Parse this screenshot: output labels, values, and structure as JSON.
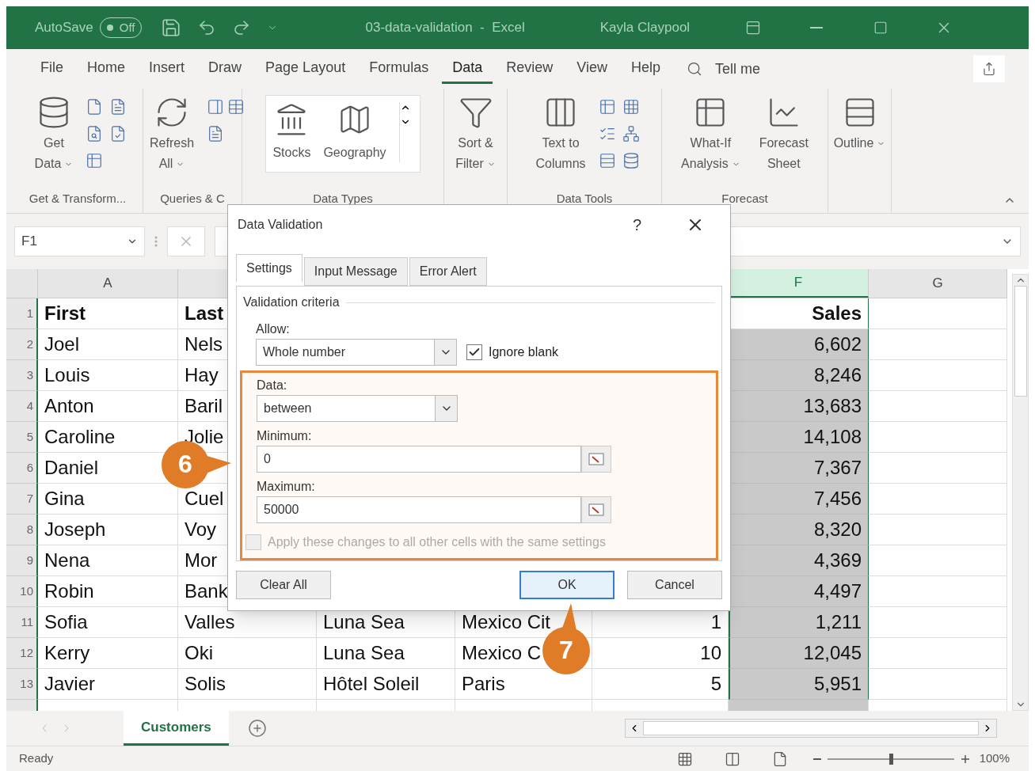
{
  "title_bar": {
    "autosave": {
      "label": "AutoSave",
      "state": "Off",
      "on": false
    },
    "title": "03-data-validation  -  Excel",
    "user": "Kayla Claypool"
  },
  "ribbon_tabs": [
    {
      "label": "File",
      "selected": false
    },
    {
      "label": "Home",
      "selected": false
    },
    {
      "label": "Insert",
      "selected": false
    },
    {
      "label": "Draw",
      "selected": false
    },
    {
      "label": "Page Layout",
      "selected": false
    },
    {
      "label": "Formulas",
      "selected": false
    },
    {
      "label": "Data",
      "selected": true
    },
    {
      "label": "Review",
      "selected": false
    },
    {
      "label": "View",
      "selected": false
    },
    {
      "label": "Help",
      "selected": false
    }
  ],
  "tell_me": "Tell me",
  "ribbon": {
    "groups": [
      {
        "kind": "buttons",
        "label": "Get & Transform...",
        "buttons": [
          {
            "lines": [
              "Get",
              "Data"
            ],
            "dropdown": true
          }
        ]
      },
      {
        "kind": "buttons",
        "label": "Queries & C",
        "buttons": [
          {
            "lines": [
              "Refresh",
              "All"
            ],
            "dropdown": true
          }
        ]
      },
      {
        "kind": "gallery",
        "label": "Data Types",
        "buttons": [
          {
            "lines": [
              "Stocks"
            ]
          },
          {
            "lines": [
              "Geography"
            ]
          }
        ]
      },
      {
        "kind": "buttons",
        "buttons": [
          {
            "lines": [
              "Sort &",
              "Filter"
            ],
            "dropdown": true
          }
        ]
      },
      {
        "kind": "buttons",
        "label": "Data Tools",
        "buttons": [
          {
            "lines": [
              "Text to",
              "Columns"
            ],
            "dropdown": false
          }
        ]
      },
      {
        "kind": "buttons",
        "label": "Forecast",
        "buttons": [
          {
            "lines": [
              "What-If",
              "Analysis"
            ],
            "dropdown": true
          },
          {
            "lines": [
              "Forecast",
              "Sheet"
            ],
            "dropdown": false
          }
        ]
      },
      {
        "kind": "buttons",
        "buttons": [
          {
            "lines": [
              "Outline"
            ],
            "dropdown": true
          }
        ]
      }
    ]
  },
  "formula_bar": {
    "name_box": "F1"
  },
  "sheet": {
    "columns": [
      {
        "label": "A",
        "selected": false
      },
      {
        "label": "F",
        "selected": true
      },
      {
        "label": "G",
        "selected": false
      }
    ],
    "rows": [
      {
        "number": "1",
        "cells": {
          "A": "First",
          "B": "Last",
          "F": "Sales"
        }
      },
      {
        "number": "2",
        "cells": {
          "A": "Joel",
          "B": "Nels",
          "F": "6,602"
        }
      },
      {
        "number": "3",
        "cells": {
          "A": "Louis",
          "B": "Hay",
          "F": "8,246"
        }
      },
      {
        "number": "4",
        "cells": {
          "A": "Anton",
          "B": "Baril",
          "F": "13,683"
        }
      },
      {
        "number": "5",
        "cells": {
          "A": "Caroline",
          "B": "Jolie",
          "F": "14,108"
        }
      },
      {
        "number": "6",
        "cells": {
          "A": "Daniel",
          "F": "7,367"
        }
      },
      {
        "number": "7",
        "cells": {
          "A": "Gina",
          "B": "Cuel",
          "F": "7,456"
        }
      },
      {
        "number": "8",
        "cells": {
          "A": "Joseph",
          "B": "Voy",
          "F": "8,320"
        }
      },
      {
        "number": "9",
        "cells": {
          "A": "Nena",
          "B": "Mor",
          "F": "4,369"
        }
      },
      {
        "number": "10",
        "cells": {
          "A": "Robin",
          "B": "Bank",
          "F": "4,497"
        }
      },
      {
        "number": "11",
        "cells": {
          "A": "Sofia",
          "B": "Valles",
          "C": "Luna Sea",
          "D": "Mexico Cit",
          "E": "1",
          "F": "1,211"
        }
      },
      {
        "number": "12",
        "cells": {
          "A": "Kerry",
          "B": "Oki",
          "C": "Luna Sea",
          "D": "Mexico C",
          "E": "10",
          "F": "12,045"
        }
      },
      {
        "number": "13",
        "cells": {
          "A": "Javier",
          "B": "Solis",
          "C": "Hôtel Soleil",
          "D": "Paris",
          "E": "5",
          "F": "5,951"
        }
      }
    ]
  },
  "dialog": {
    "title": "Data Validation",
    "help": "?",
    "tabs": [
      {
        "label": "Settings",
        "selected": true
      },
      {
        "label": "Input Message",
        "selected": false
      },
      {
        "label": "Error Alert",
        "selected": false
      }
    ],
    "section": "Validation criteria",
    "allow": {
      "label": "Allow:",
      "value": "Whole number"
    },
    "ignore_blank": {
      "label": "Ignore blank",
      "checked": true
    },
    "data": {
      "label": "Data:",
      "value": "between"
    },
    "minimum": {
      "label": "Minimum:",
      "value": "0"
    },
    "maximum": {
      "label": "Maximum:",
      "value": "50000"
    },
    "apply_all": {
      "label": "Apply these changes to all other cells with the same settings",
      "checked": false,
      "disabled": true
    },
    "buttons": [
      {
        "label": "Clear All",
        "default": false
      },
      {
        "label": "OK",
        "default": true
      },
      {
        "label": "Cancel",
        "default": false
      }
    ]
  },
  "callouts": [
    {
      "label": "6"
    },
    {
      "label": "7"
    }
  ],
  "sheet_tabs": [
    {
      "label": "Customers",
      "selected": true
    }
  ],
  "status_bar": {
    "status": "Ready",
    "zoom": {
      "level": 0.5,
      "reading": "100%"
    }
  }
}
